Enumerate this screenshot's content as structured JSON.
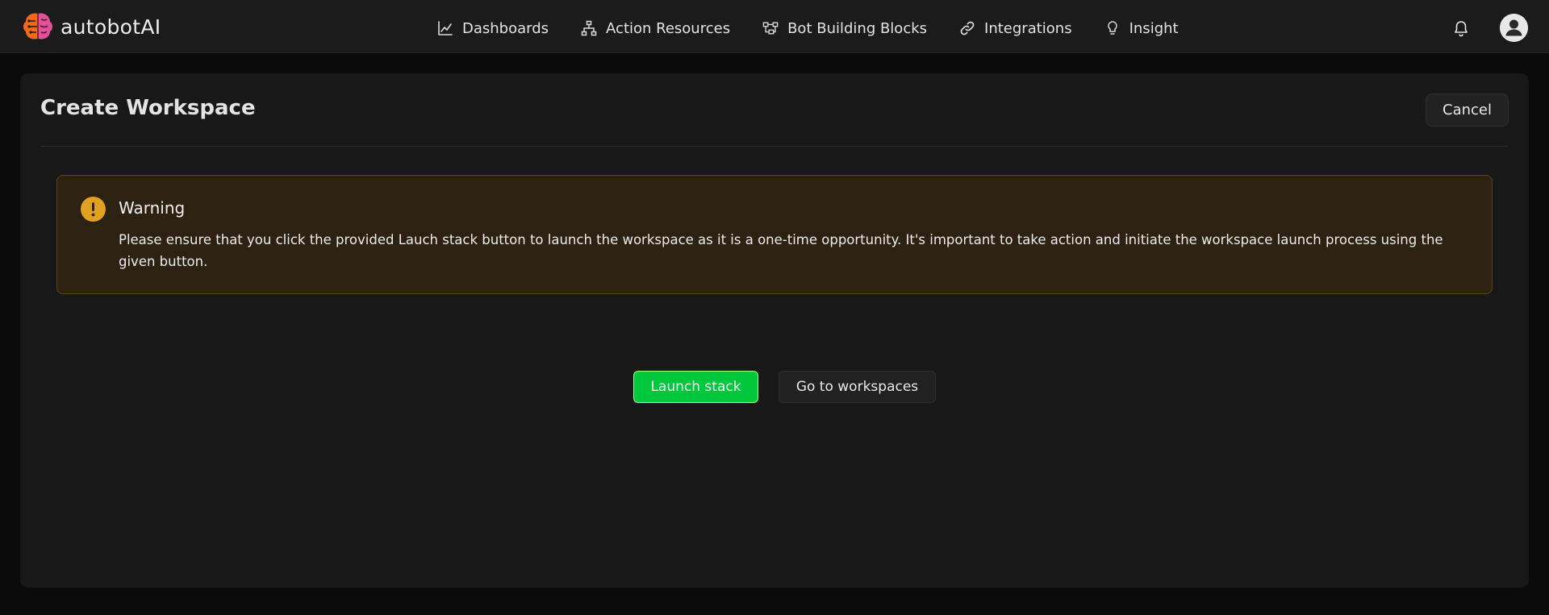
{
  "brand": {
    "name": "autobotAI"
  },
  "nav": {
    "items": [
      {
        "label": "Dashboards",
        "icon": "line-chart-icon"
      },
      {
        "label": "Action Resources",
        "icon": "sitemap-icon"
      },
      {
        "label": "Bot Building Blocks",
        "icon": "blocks-icon"
      },
      {
        "label": "Integrations",
        "icon": "link-icon"
      },
      {
        "label": "Insight",
        "icon": "lightbulb-icon"
      }
    ]
  },
  "header": {
    "notifications_icon": "bell-icon",
    "avatar_icon": "user-avatar-icon"
  },
  "page": {
    "title": "Create Workspace",
    "cancel_label": "Cancel"
  },
  "alert": {
    "title": "Warning",
    "message": "Please ensure that you click the provided Lauch stack button to launch the workspace as it is a one-time opportunity. It's important to take action and initiate the workspace launch process using the given button.",
    "accent": "#e0a020"
  },
  "actions": {
    "launch_label": "Launch stack",
    "goto_label": "Go to workspaces"
  },
  "colors": {
    "accent_green": "#00c73b",
    "background": "#0b0b0b",
    "card": "#181818"
  }
}
